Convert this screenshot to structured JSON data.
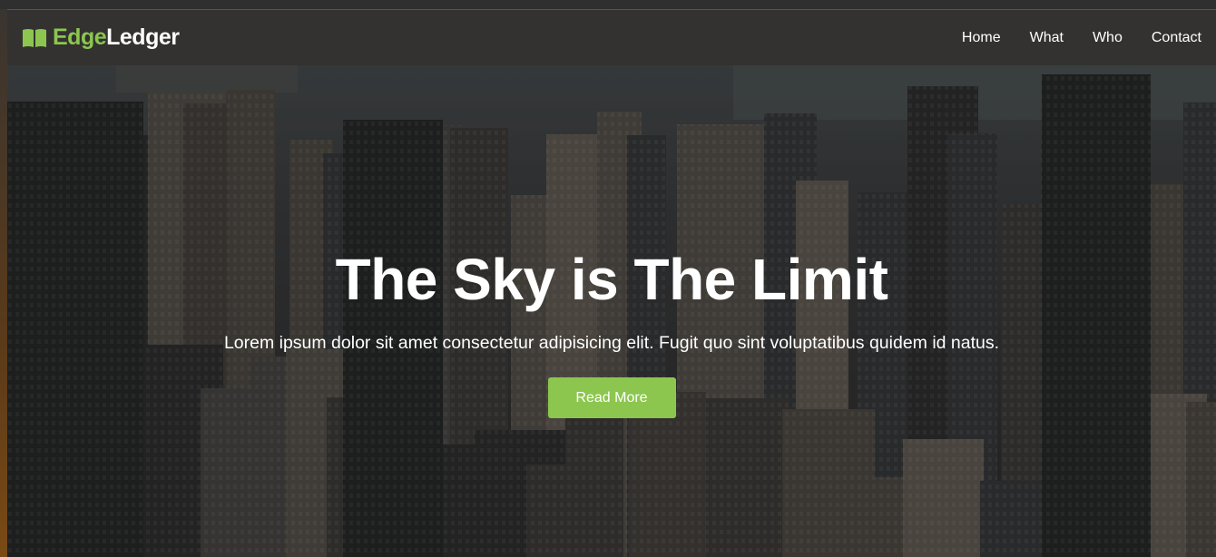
{
  "brand": {
    "part1": "Edge",
    "part2": "Ledger",
    "icon": "open-book-icon",
    "accent_color": "#8cc64f"
  },
  "nav": {
    "links": [
      "Home",
      "What",
      "Who",
      "Contact"
    ]
  },
  "hero": {
    "title": "The Sky is The Limit",
    "subtitle": "Lorem ipsum dolor sit amet consectetur adipisicing elit. Fugit quo sint voluptatibus quidem id natus.",
    "button_label": "Read More",
    "background": "city-skyline-aerial-photo"
  }
}
